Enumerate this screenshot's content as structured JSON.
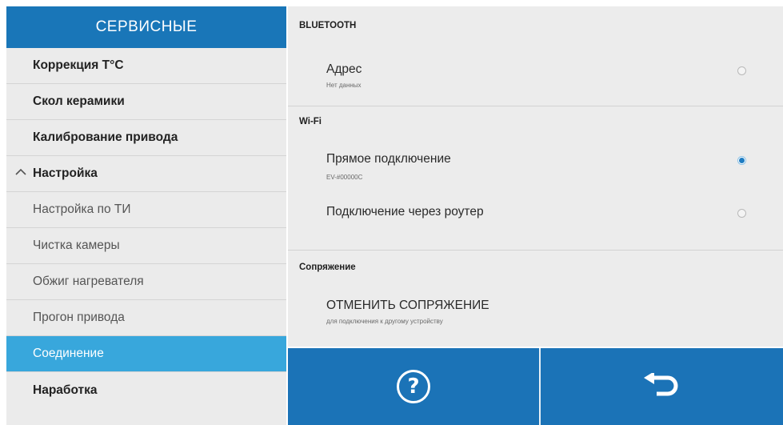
{
  "sidebar": {
    "header": "СЕРВИСНЫЕ",
    "items": [
      {
        "label": "Коррекция Т°C"
      },
      {
        "label": "Скол керамики"
      },
      {
        "label": "Калибрование привода"
      },
      {
        "label": "Настройка"
      },
      {
        "label": "Настройка по ТИ"
      },
      {
        "label": "Чистка камеры"
      },
      {
        "label": "Обжиг нагревателя"
      },
      {
        "label": "Прогон привода"
      },
      {
        "label": "Соединение"
      },
      {
        "label": "Наработка"
      }
    ]
  },
  "main": {
    "bluetooth": {
      "header": "BLUETOOTH",
      "address_title": "Адрес",
      "address_sub": "Нет данных",
      "address_selected": false
    },
    "wifi": {
      "header": "Wi-Fi",
      "direct_title": "Прямое подключение",
      "direct_sub": "EV-#00000C",
      "direct_selected": true,
      "router_title": "Подключение через роутер",
      "router_selected": false
    },
    "pairing": {
      "header": "Сопряжение",
      "cancel_title": "ОТМЕНИТЬ СОПРЯЖЕНИЕ",
      "cancel_sub": "для подключения к другому устройству"
    }
  },
  "buttons": {
    "help_glyph": "?",
    "help_icon": "question-circle-icon",
    "back_icon": "return-arrow-icon"
  },
  "colors": {
    "header_blue": "#1976b8",
    "active_item": "#38a7dc",
    "button_blue": "#1b73b7",
    "radio_selected": "#1f7cc2"
  }
}
